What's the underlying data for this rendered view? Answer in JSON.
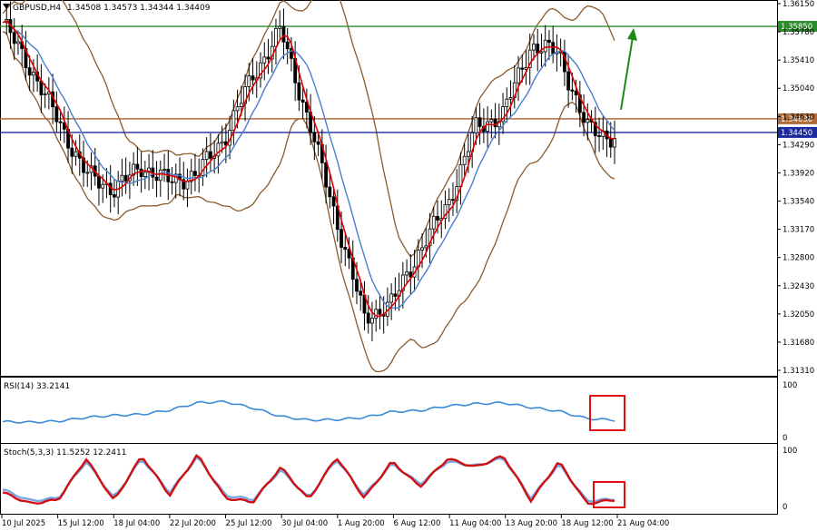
{
  "header": {
    "symbol": "GBPUSD,H4",
    "ohlc": "1.34508 1.34573 1.34344 1.34409"
  },
  "colors": {
    "candle": "#000000",
    "ma_fast": "#e00000",
    "ma_slow": "#4a7fd0",
    "bollinger": "#8b5a2b",
    "resistance": "#2a8c2a",
    "pivot": "#b06a3a",
    "support": "#1c2aa0",
    "rsi": "#3a8ad8",
    "stoch_main": "#d01010",
    "stoch_signal": "#7aa6e6",
    "highlight_box": "#e01010",
    "arrow": "#1a8a1a",
    "ruler_tag": "#000000"
  },
  "chart_data": [
    {
      "type": "candlestick",
      "title": "GBPUSD,H4",
      "y_ticks": [
        "1.36150",
        "1.35780",
        "1.35410",
        "1.35040",
        "1.34630",
        "1.34290",
        "1.33920",
        "1.33540",
        "1.33170",
        "1.32800",
        "1.32430",
        "1.32050",
        "1.31680",
        "1.31310"
      ],
      "ylim": [
        1.3131,
        1.3615
      ],
      "x_ticks": [
        "10 Jul 2025",
        "15 Jul 12:00",
        "18 Jul 04:00",
        "22 Jul 20:00",
        "25 Jul 12:00",
        "30 Jul 04:00",
        "1 Aug 20:00",
        "6 Aug 12:00",
        "11 Aug 04:00",
        "13 Aug 20:00",
        "18 Aug 12:00",
        "21 Aug 04:00"
      ],
      "horizontal_lines": [
        {
          "label": "1.35850",
          "value": 1.3585,
          "color": "resistance"
        },
        {
          "label": "1.34630",
          "value": 1.3463,
          "color": "pivot"
        },
        {
          "label": "1.34450",
          "value": 1.3445,
          "color": "support"
        }
      ],
      "series": [
        {
          "type": "line",
          "values": [
            1.359,
            1.353,
            1.346,
            1.339,
            1.337,
            1.34,
            1.338,
            1.339,
            1.344,
            1.352,
            1.358,
            1.346,
            1.333,
            1.32,
            1.322,
            1.329,
            1.335,
            1.345,
            1.347,
            1.356,
            1.355,
            1.345,
            1.3438
          ]
        },
        {
          "type": "line",
          "values": [
            1.357,
            1.351,
            1.344,
            1.34,
            1.339,
            1.339,
            1.338,
            1.341,
            1.346,
            1.351,
            1.354,
            1.348,
            1.336,
            1.325,
            1.324,
            1.329,
            1.333,
            1.343,
            1.347,
            1.354,
            1.355,
            1.347,
            1.345
          ]
        }
      ]
    },
    {
      "type": "line",
      "title": "RSI(14) 33.2141",
      "ylim": [
        0,
        100
      ],
      "y_ticks": [
        "100",
        "0"
      ],
      "series": [
        {
          "type": "line",
          "values": [
            30,
            29,
            31,
            38,
            42,
            44,
            52,
            66,
            68,
            56,
            40,
            33,
            34,
            38,
            49,
            51,
            60,
            64,
            66,
            57,
            50,
            36,
            33
          ]
        }
      ]
    },
    {
      "type": "line",
      "title": "Stoch(5,3,3) 11.5252 12.2411",
      "ylim": [
        0,
        100
      ],
      "y_ticks": [
        "100",
        "0"
      ],
      "series": [
        {
          "type": "line",
          "values": [
            25,
            5,
            12,
            85,
            10,
            90,
            20,
            92,
            15,
            8,
            70,
            12,
            88,
            15,
            80,
            35,
            85,
            70,
            90,
            10,
            80,
            5,
            12
          ]
        },
        {
          "type": "line",
          "values": [
            30,
            10,
            15,
            80,
            15,
            85,
            25,
            88,
            20,
            12,
            65,
            15,
            84,
            20,
            76,
            40,
            80,
            72,
            86,
            15,
            75,
            10,
            13
          ]
        }
      ]
    }
  ]
}
